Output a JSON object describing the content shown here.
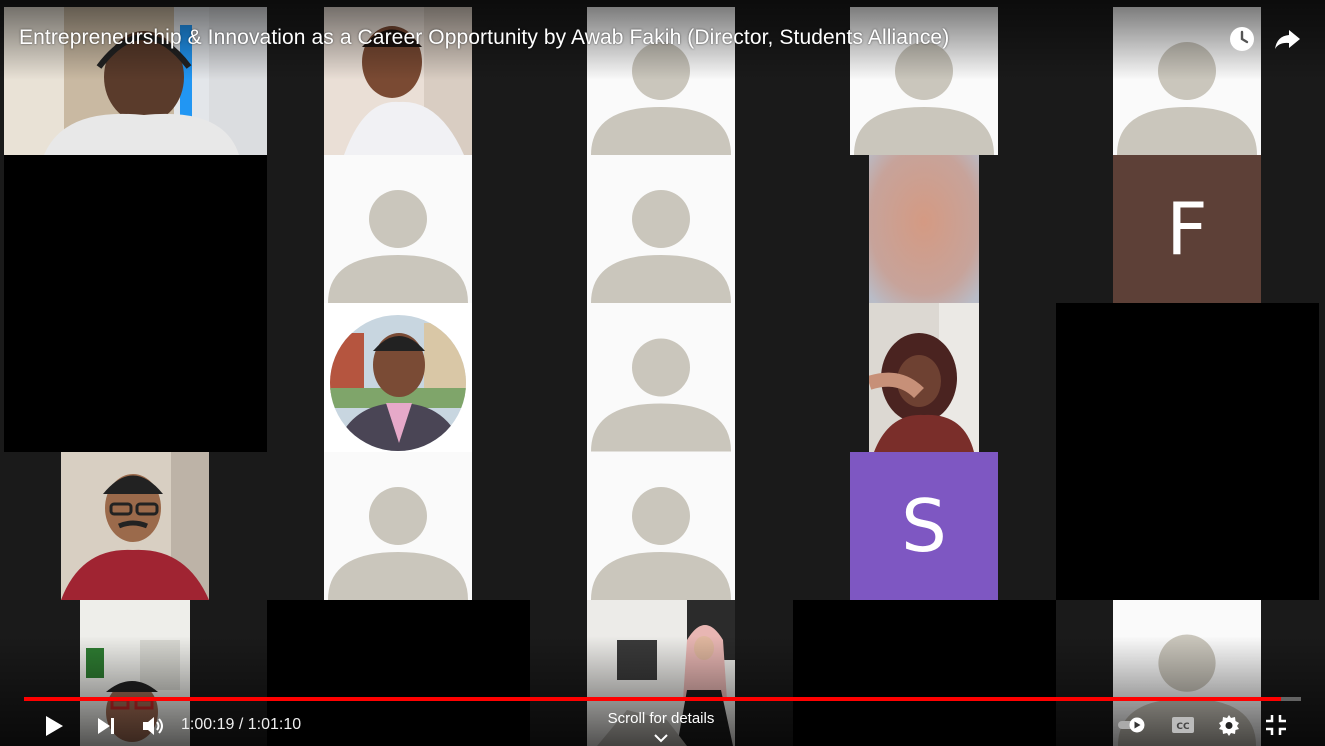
{
  "video": {
    "title": "Entrepreneurship & Innovation as a Career Opportunity by Awab Fakih (Director, Students Alliance)",
    "progress_fraction": 0.984
  },
  "grid": {
    "letter_tiles": [
      {
        "letter": "F",
        "color": "#5d4037"
      },
      {
        "letter": "S",
        "color": "#7e57c2"
      }
    ]
  },
  "controls": {
    "current_time": "1:00:19",
    "duration": "1:01:10",
    "time_separator": " / ",
    "scroll_details_label": "Scroll for details"
  },
  "icons": {
    "watch_later": "clock-icon",
    "share": "share-arrow-icon",
    "play": "play-icon",
    "next": "next-icon",
    "volume": "volume-icon",
    "autoplay": "autoplay-toggle-icon",
    "captions": "cc-icon",
    "settings": "gear-icon",
    "exit_fullscreen": "exit-fullscreen-icon",
    "chevron": "chevron-down-icon"
  }
}
